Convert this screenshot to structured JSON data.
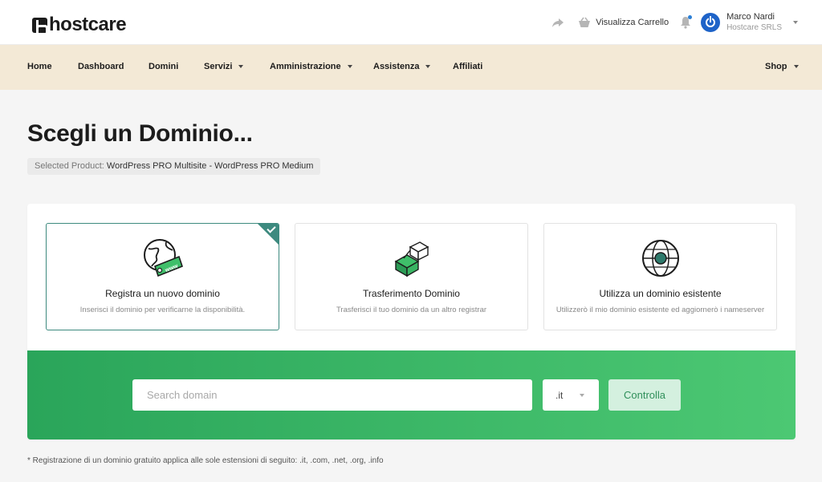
{
  "header": {
    "brand": "hostcare",
    "cart_label": "Visualizza Carrello",
    "user_name": "Marco Nardi",
    "user_company": "Hostcare SRLS"
  },
  "nav": {
    "items": [
      {
        "label": "Home",
        "dropdown": false
      },
      {
        "label": "Dashboard",
        "dropdown": false
      },
      {
        "label": "Domini",
        "dropdown": false
      },
      {
        "label": "Servizi",
        "dropdown": true
      },
      {
        "label": "Amministrazione",
        "dropdown": true
      },
      {
        "label": "Assistenza",
        "dropdown": true
      },
      {
        "label": "Affiliati",
        "dropdown": false
      }
    ],
    "shop_label": "Shop"
  },
  "page": {
    "title": "Scegli un Dominio...",
    "selected_product_label": "Selected Product:",
    "selected_product": "WordPress PRO Multisite - WordPress PRO Medium"
  },
  "options": [
    {
      "title": "Registra un nuovo dominio",
      "description": "Inserisci il dominio per verificarne la disponibilità.",
      "selected": true
    },
    {
      "title": "Trasferimento Dominio",
      "description": "Trasferisci il tuo dominio da un altro registrar",
      "selected": false
    },
    {
      "title": "Utilizza un dominio esistente",
      "description": "Utilizzerò il mio dominio esistente ed aggiornerò i nameserver",
      "selected": false
    }
  ],
  "search": {
    "placeholder": "Search domain",
    "value": "",
    "tld_selected": ".it",
    "button_label": "Controlla"
  },
  "footnote": "* Registrazione di un dominio gratuito applica alle sole estensioni di seguito: .it, .com, .net, .org, .info",
  "colors": {
    "nav_bg": "#f3e9d6",
    "accent_teal": "#3d8a7f",
    "search_green_start": "#2aa55a",
    "search_green_end": "#4cc873",
    "avatar_blue": "#1e63c8"
  }
}
